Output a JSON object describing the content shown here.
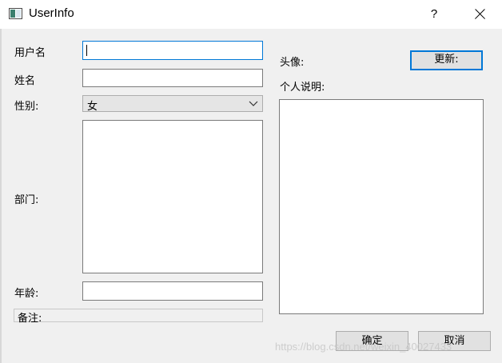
{
  "window": {
    "title": "UserInfo",
    "help_label": "?"
  },
  "form": {
    "username_label": "用户名",
    "username_value": "",
    "name_label": "姓名",
    "name_value": "",
    "gender_label": "性别:",
    "gender_value": "女",
    "department_label": "部门:",
    "department_value": "",
    "age_label": "年龄:",
    "age_value": "",
    "remark_label": "备注:"
  },
  "side": {
    "avatar_label": "头像:",
    "update_button": "更新:",
    "bio_label": "个人说明:",
    "bio_value": ""
  },
  "actions": {
    "ok_label": "确定",
    "cancel_label": "取消"
  },
  "watermark": "https://blog.csdn.net/weixin_40027433"
}
